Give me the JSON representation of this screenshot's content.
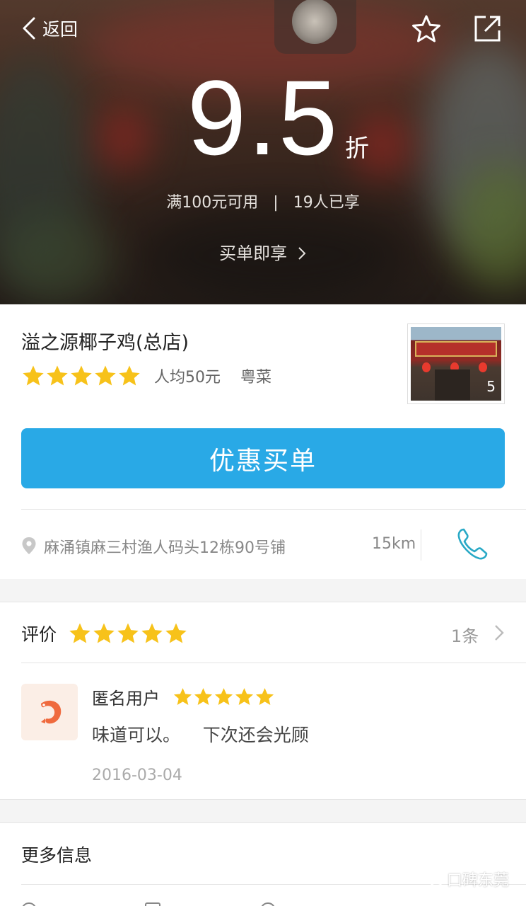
{
  "nav": {
    "back_label": "返回"
  },
  "hero": {
    "discount_value": "9.5",
    "discount_unit": "折",
    "min_spend": "满100元可用",
    "separator": "|",
    "used_count": "19人已享",
    "buy_link": "买单即享"
  },
  "shop": {
    "name": "溢之源椰子鸡(总店)",
    "rating_stars": 5,
    "avg_price": "人均50元",
    "cuisine": "粤菜",
    "photo_count": "5",
    "pay_button": "优惠买单",
    "address": "麻涌镇麻三村渔人码头12栋90号铺",
    "distance": "15km"
  },
  "reviews": {
    "title": "评价",
    "rating_stars": 5,
    "count": "1条",
    "items": [
      {
        "user": "匿名用户",
        "stars": 5,
        "text": "味道可以。    下次还会光顾",
        "date": "2016-03-04"
      }
    ]
  },
  "more": {
    "title": "更多信息"
  },
  "watermark": {
    "text": "口碑东莞"
  },
  "colors": {
    "accent": "#29a9e6",
    "star": "#f7c21a",
    "phone": "#29a9c6"
  },
  "icons": [
    "back-chevron-icon",
    "star-outline-icon",
    "share-icon",
    "chevron-right-icon",
    "star-icon",
    "location-pin-icon",
    "phone-icon",
    "shrimp-icon",
    "wechat-icon"
  ]
}
